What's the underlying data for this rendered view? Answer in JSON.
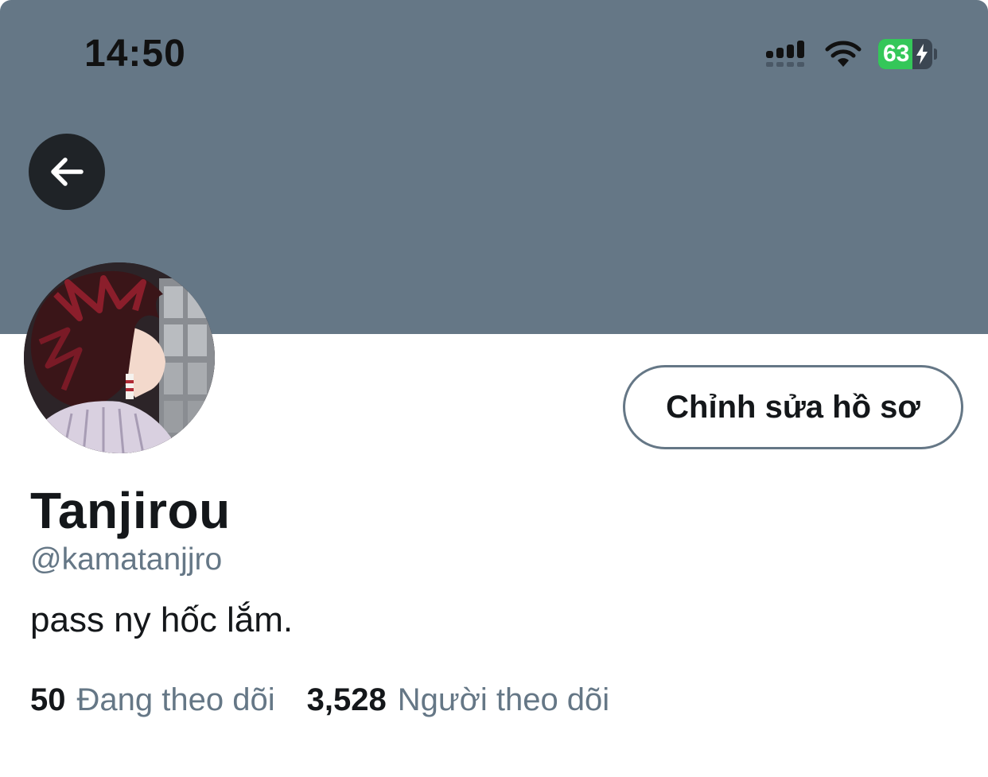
{
  "status_bar": {
    "time": "14:50",
    "battery_level": "63",
    "battery_fraction": 0.63,
    "icons": [
      "signal-icon",
      "wifi-icon",
      "battery-charging-icon"
    ]
  },
  "header": {
    "banner_color": "#657786",
    "back_icon": "arrow-left-icon"
  },
  "profile": {
    "edit_button_label": "Chỉnh sửa hồ sơ",
    "display_name": "Tanjirou",
    "handle": "@kamatanjjro",
    "bio": "pass ny hốc lắm."
  },
  "stats": {
    "following_count": "50",
    "following_label": "Đang theo dõi",
    "followers_count": "3,528",
    "followers_label": "Người theo dõi"
  },
  "colors": {
    "accent_gray": "#657786",
    "text_primary": "#14171a",
    "battery_green": "#34c759"
  }
}
